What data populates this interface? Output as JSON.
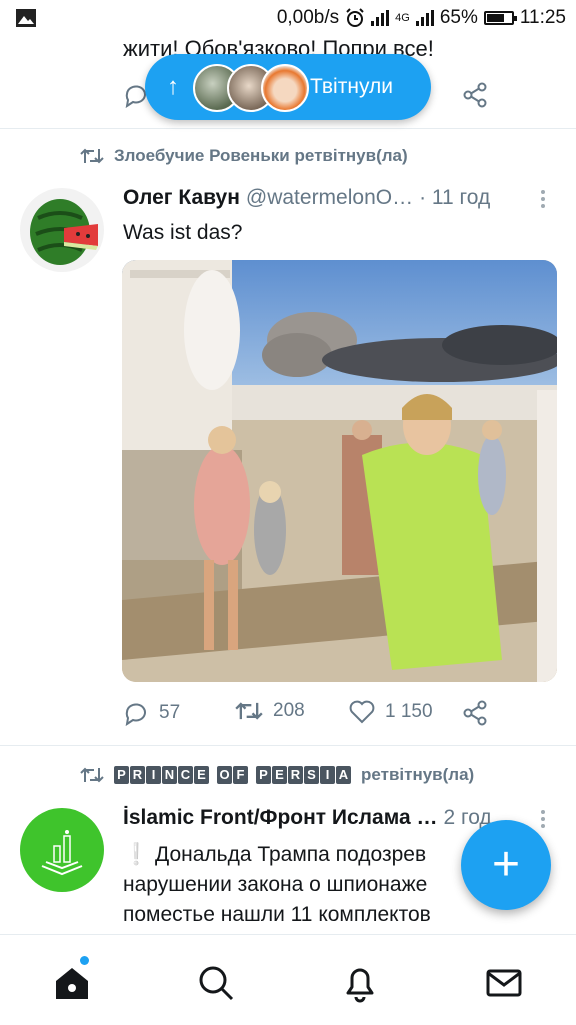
{
  "status_bar": {
    "speed": "0,00b/s",
    "network": "4G",
    "battery": "65%",
    "time": "11:25",
    "battery_level": 0.65
  },
  "previous_tweet": {
    "text_tail": "жити! Обов'язково! Попри все!"
  },
  "new_tweets_pill": {
    "arrow": "↑",
    "label": "Твітнули"
  },
  "tweets": [
    {
      "retweeted_by": "Злоебучие Ровеньки ретвітнув(ла)",
      "name": "Олег Кавун",
      "handle": "@watermelonO…",
      "time": "· 11 год",
      "text": "Was ist das?",
      "replies": "57",
      "retweets": "208",
      "likes": "1 150"
    },
    {
      "retweeted_by_name": "PRINCE OF PERSIA",
      "retweeted_by_suffix": "ретвітнув(ла)",
      "name": "İslamic Front/Фронт Ислама …",
      "time": "2 год",
      "text_line1": "❕ Дональда Трампа подозрев",
      "text_line2": "нарушении закона о шпионаже",
      "text_line3": "поместье нашли 11 комплектов"
    }
  ],
  "fab_label": "+",
  "colors": {
    "accent": "#1da1f2",
    "muted": "#657786"
  },
  "icons": [
    "image-icon",
    "alarm-icon",
    "signal-icon",
    "battery-icon",
    "reply-icon",
    "retweet-icon",
    "like-icon",
    "share-icon",
    "home-icon",
    "search-icon",
    "bell-icon",
    "mail-icon"
  ]
}
